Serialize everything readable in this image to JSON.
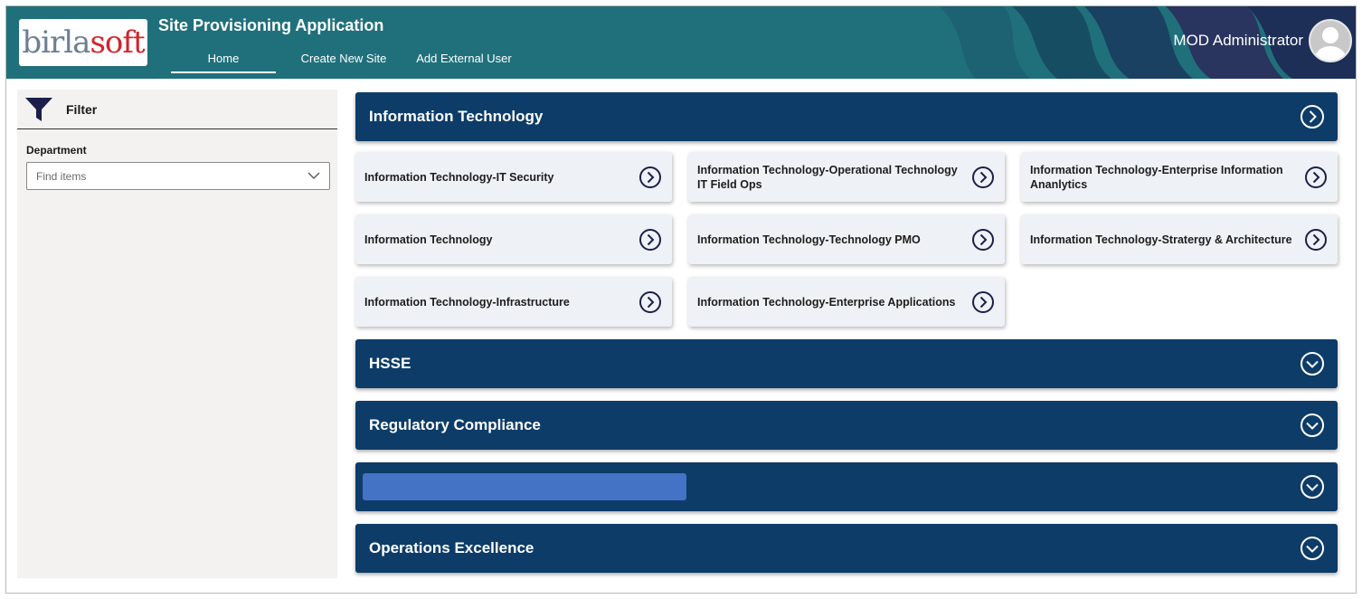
{
  "header": {
    "logo": {
      "part1": "birla",
      "part2": "soft"
    },
    "title": "Site Provisioning Application",
    "nav": [
      {
        "label": "Home",
        "active": true
      },
      {
        "label": "Create New Site",
        "active": false
      },
      {
        "label": "Add External User",
        "active": false
      }
    ],
    "user_name": "MOD Administrator"
  },
  "filter": {
    "title": "Filter",
    "department_label": "Department",
    "department_placeholder": "Find items"
  },
  "sections": [
    {
      "title": "Information Technology",
      "expanded": true,
      "items": [
        {
          "label": "Information Technology-IT Security"
        },
        {
          "label": "Information Technology-Operational Technology IT Field Ops"
        },
        {
          "label": "Information Technology-Enterprise Information Ananlytics"
        },
        {
          "label": "Information Technology"
        },
        {
          "label": "Information Technology-Technology PMO"
        },
        {
          "label": "Information Technology-Stratergy & Architecture"
        },
        {
          "label": "Information Technology-Infrastructure"
        },
        {
          "label": "Information Technology-Enterprise Applications"
        }
      ]
    },
    {
      "title": "HSSE",
      "expanded": false
    },
    {
      "title": "Regulatory Compliance",
      "expanded": false
    },
    {
      "title": "",
      "expanded": false,
      "redacted": true
    },
    {
      "title": "Operations Excellence",
      "expanded": false
    }
  ],
  "colors": {
    "header_bg": "#20707c",
    "section_bg": "#0d3c68",
    "card_bg": "#eef1f5",
    "panel_bg": "#f3f2f1",
    "redaction": "#4472c4",
    "icon_dark": "#1b1f4a"
  },
  "icons": {
    "filter": "funnel-icon",
    "expand": "chevron-right-circle-icon",
    "collapse": "chevron-down-circle-icon",
    "dropdown": "chevron-down-icon",
    "user": "person-icon"
  }
}
